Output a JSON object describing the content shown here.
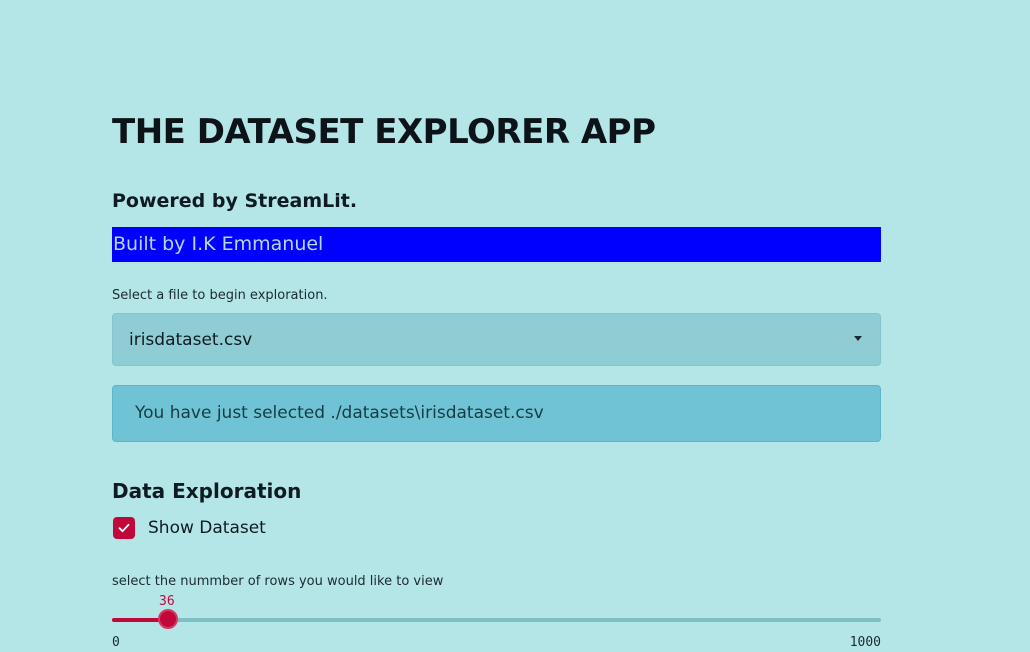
{
  "app": {
    "title": "THE DATASET EXPLORER APP",
    "powered_by": "Powered by StreamLit.",
    "built_by": "Built by I.K Emmanuel"
  },
  "file_select": {
    "label": "Select a file to begin exploration.",
    "value": "irisdataset.csv",
    "icon": "chevron-down-icon"
  },
  "info_box": {
    "text": "You have just selected ./datasets\\irisdataset.csv"
  },
  "exploration": {
    "heading": "Data Exploration",
    "show_dataset": {
      "label": "Show Dataset",
      "checked": true,
      "icon": "check-icon"
    }
  },
  "rows_slider": {
    "label": "select the nummber of rows you would like to view",
    "value": 36,
    "min": 0,
    "max": 1000,
    "value_text": "36",
    "min_text": "0",
    "max_text": "1000"
  },
  "colors": {
    "background": "#b5e6e7",
    "accent": "#c0093a",
    "built_by_bg": "#0000ff",
    "info_bg": "#6fc3d4",
    "select_bg": "#8fcdd5"
  }
}
